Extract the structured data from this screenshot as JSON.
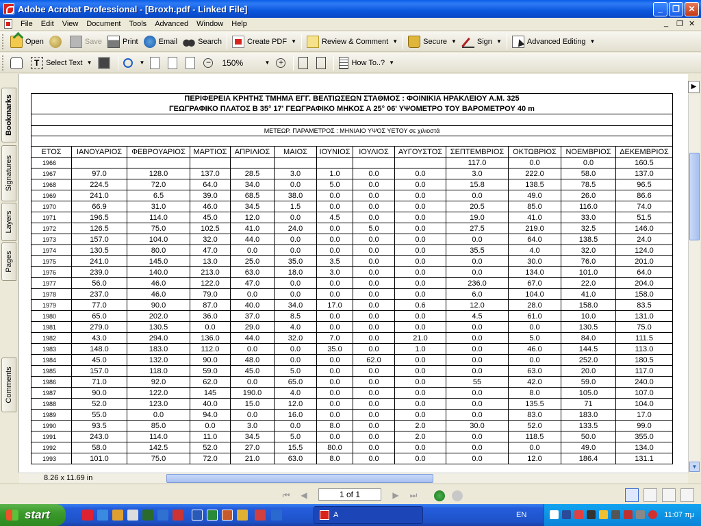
{
  "window": {
    "title": "Adobe Acrobat Professional - [Broxh.pdf - Linked File]",
    "controls": {
      "minimize": "_",
      "maximize": "❐",
      "close": "✕"
    }
  },
  "menu": {
    "items": [
      "File",
      "Edit",
      "View",
      "Document",
      "Tools",
      "Advanced",
      "Window",
      "Help"
    ],
    "mdi_controls": {
      "minimize": "_",
      "restore": "❐",
      "close": "✕"
    }
  },
  "toolbar1": {
    "open": "Open",
    "save": "Save",
    "print": "Print",
    "email": "Email",
    "search": "Search",
    "create_pdf": "Create PDF",
    "review": "Review & Comment",
    "secure": "Secure",
    "sign": "Sign",
    "advanced_editing": "Advanced Editing"
  },
  "toolbar2": {
    "select_text": "Select Text",
    "zoom": "150%",
    "how_to": "How To..?"
  },
  "nav_tabs": [
    "Bookmarks",
    "Signatures",
    "Layers",
    "Pages",
    "Comments"
  ],
  "document": {
    "header_line1": "ΠΕΡΙΦΕΡΕΙΑ ΚΡΗΤΗΣ ΤΜΗΜΑ ΕΓΓ. ΒΕΛΤΙΩΣΕΩΝ          ΣΤΑΘΜΟΣ : ΦΟΙΝΙΚΙΑ ΗΡΑΚΛΕΙΟΥ     Α.Μ. 325",
    "header_line2": "ΓΕΩΓΡΑΦΙΚΟ ΠΛΑΤΟΣ    Β 35° 17'                 ΓΕΩΓΡΑΦΙΚΟ ΜΗΚΟΣ   Α  25° 06'                       ΥΨΟΜΕΤΡΟ ΤΟΥ ΒΑΡΟΜΕΤΡΟΥ   40 m",
    "parameter_line": "ΜΕΤΕΩΡ. ΠΑΡΑΜΕΤΡΟΣ : ΜΗΝΙΑΙΟ ΥΨΟΣ ΥΕΤΟΥ σε χιλιοστά",
    "columns": [
      "ΕΤΟΣ",
      "ΙΑΝΟΥΑΡΙΟΣ",
      "ΦΕΒΡΟΥΑΡΙΟΣ",
      "ΜΑΡΤΙΟΣ",
      "ΑΠΡΙΛΙΟΣ",
      "ΜΑΙΟΣ",
      "ΙΟΥΝΙΟΣ",
      "ΙΟΥΛΙΟΣ",
      "ΑΥΓΟΥΣΤΟΣ",
      "ΣΕΠΤΕΜΒΡΙΟΣ",
      "ΟΚΤΩΒΡΙΟΣ",
      "ΝΟΕΜΒΡΙΟΣ",
      "ΔΕΚΕΜΒΡΙΟΣ"
    ],
    "rows": [
      [
        "1966",
        "",
        "",
        "",
        "",
        "",
        "",
        "",
        "",
        "117.0",
        "0.0",
        "0.0",
        "160.5"
      ],
      [
        "1967",
        "97.0",
        "128.0",
        "137.0",
        "28.5",
        "3.0",
        "1.0",
        "0.0",
        "0.0",
        "3.0",
        "222.0",
        "58.0",
        "137.0"
      ],
      [
        "1968",
        "224.5",
        "72.0",
        "64.0",
        "34.0",
        "0.0",
        "5.0",
        "0.0",
        "0.0",
        "15.8",
        "138.5",
        "78.5",
        "96.5"
      ],
      [
        "1969",
        "241.0",
        "6.5",
        "39.0",
        "68.5",
        "38.0",
        "0.0",
        "0.0",
        "0.0",
        "0.0",
        "49.0",
        "26.0",
        "86.6"
      ],
      [
        "1970",
        "66.9",
        "31.0",
        "46.0",
        "34.5",
        "1.5",
        "0.0",
        "0.0",
        "0.0",
        "20.5",
        "85.0",
        "116.0",
        "74.0"
      ],
      [
        "1971",
        "196.5",
        "114.0",
        "45.0",
        "12.0",
        "0.0",
        "4.5",
        "0.0",
        "0.0",
        "19.0",
        "41.0",
        "33.0",
        "51.5"
      ],
      [
        "1972",
        "126.5",
        "75.0",
        "102.5",
        "41.0",
        "24.0",
        "0.0",
        "5.0",
        "0.0",
        "27.5",
        "219.0",
        "32.5",
        "146.0"
      ],
      [
        "1973",
        "157.0",
        "104.0",
        "32.0",
        "44.0",
        "0.0",
        "0.0",
        "0.0",
        "0.0",
        "0.0",
        "64.0",
        "138.5",
        "24.0"
      ],
      [
        "1974",
        "130.5",
        "80.0",
        "47.0",
        "0.0",
        "0.0",
        "0.0",
        "0.0",
        "0.0",
        "35.5",
        "4.0",
        "32.0",
        "124.0"
      ],
      [
        "1975",
        "241.0",
        "145.0",
        "13.0",
        "25.0",
        "35.0",
        "3.5",
        "0.0",
        "0.0",
        "0.0",
        "30.0",
        "76.0",
        "201.0"
      ],
      [
        "1976",
        "239.0",
        "140.0",
        "213.0",
        "63.0",
        "18.0",
        "3.0",
        "0.0",
        "0.0",
        "0.0",
        "134.0",
        "101.0",
        "64.0"
      ],
      [
        "1977",
        "56.0",
        "46.0",
        "122.0",
        "47.0",
        "0.0",
        "0.0",
        "0.0",
        "0.0",
        "236.0",
        "67.0",
        "22.0",
        "204.0"
      ],
      [
        "1978",
        "237.0",
        "46.0",
        "79.0",
        "0.0",
        "0.0",
        "0.0",
        "0.0",
        "0.0",
        "6.0",
        "104.0",
        "41.0",
        "158.0"
      ],
      [
        "1979",
        "77.0",
        "90.0",
        "87.0",
        "40.0",
        "34.0",
        "17.0",
        "0.0",
        "0.6",
        "12.0",
        "28.0",
        "158.0",
        "83.5"
      ],
      [
        "1980",
        "65.0",
        "202.0",
        "36.0",
        "37.0",
        "8.5",
        "0.0",
        "0.0",
        "0.0",
        "4.5",
        "61.0",
        "10.0",
        "131.0"
      ],
      [
        "1981",
        "279.0",
        "130.5",
        "0.0",
        "29.0",
        "4.0",
        "0.0",
        "0.0",
        "0.0",
        "0.0",
        "0.0",
        "130.5",
        "75.0"
      ],
      [
        "1982",
        "43.0",
        "294.0",
        "136.0",
        "44.0",
        "32.0",
        "7.0",
        "0.0",
        "21.0",
        "0.0",
        "5.0",
        "84.0",
        "111.5"
      ],
      [
        "1983",
        "148.0",
        "183.0",
        "112.0",
        "0.0",
        "0.0",
        "35.0",
        "0.0",
        "1.0",
        "0.0",
        "46.0",
        "144.5",
        "113.0"
      ],
      [
        "1984",
        "45.0",
        "132.0",
        "90.0",
        "48.0",
        "0.0",
        "0.0",
        "62.0",
        "0.0",
        "0.0",
        "0.0",
        "252.0",
        "180.5"
      ],
      [
        "1985",
        "157.0",
        "118.0",
        "59.0",
        "45.0",
        "5.0",
        "0.0",
        "0.0",
        "0.0",
        "0.0",
        "63.0",
        "20.0",
        "117.0"
      ],
      [
        "1986",
        "71.0",
        "92.0",
        "62.0",
        "0.0",
        "65.0",
        "0.0",
        "0.0",
        "0.0",
        "55",
        "42.0",
        "59.0",
        "240.0"
      ],
      [
        "1987",
        "90.0",
        "122.0",
        "145",
        "190.0",
        "4.0",
        "0.0",
        "0.0",
        "0.0",
        "0.0",
        "8.0",
        "105.0",
        "107.0"
      ],
      [
        "1988",
        "52.0",
        "123.0",
        "40.0",
        "15.0",
        "12.0",
        "0.0",
        "0.0",
        "0.0",
        "0.0",
        "135.5",
        "71",
        "104.0"
      ],
      [
        "1989",
        "55.0",
        "0.0",
        "94.0",
        "0.0",
        "16.0",
        "0.0",
        "0.0",
        "0.0",
        "0.0",
        "83.0",
        "183.0",
        "17.0"
      ],
      [
        "1990",
        "93.5",
        "85.0",
        "0.0",
        "3.0",
        "0.0",
        "8.0",
        "0.0",
        "2.0",
        "30.0",
        "52.0",
        "133.5",
        "99.0"
      ],
      [
        "1991",
        "243.0",
        "114.0",
        "11.0",
        "34.5",
        "5.0",
        "0.0",
        "0.0",
        "2.0",
        "0.0",
        "118.5",
        "50.0",
        "355.0"
      ],
      [
        "1992",
        "58.0",
        "142.5",
        "52.0",
        "27.0",
        "15.5",
        "80.0",
        "0.0",
        "0.0",
        "0.0",
        "0.0",
        "49.0",
        "134.0"
      ],
      [
        "1993",
        "101.0",
        "75.0",
        "72.0",
        "21.0",
        "63.0",
        "8.0",
        "0.0",
        "0.0",
        "0.0",
        "12.0",
        "186.4",
        "131.1"
      ]
    ]
  },
  "status": {
    "page_size": "8.26 x 11.69 in",
    "page_info": "1 of 1"
  },
  "taskbar": {
    "start": "start",
    "task_label": "A",
    "language": "EN",
    "clock": "11:07 πμ"
  }
}
